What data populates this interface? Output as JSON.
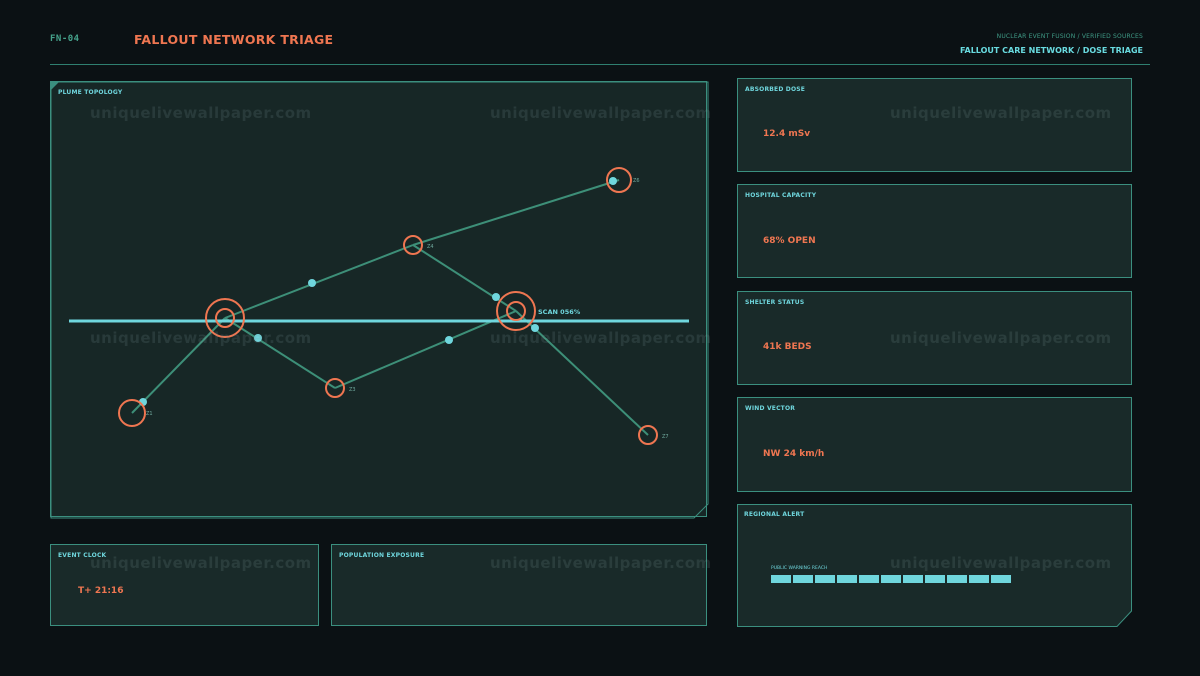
{
  "header": {
    "code": "FN-04",
    "title": "FALLOUT NETWORK TRIAGE",
    "subtitle": "NUCLEAR EVENT FUSION / VERIFIED SOURCES",
    "network_title": "FALLOUT CARE NETWORK / DOSE TRIAGE"
  },
  "plume": {
    "label": "PLUME TOPOLOGY",
    "scan_label": "SCAN 056%",
    "zones": [
      "Z1",
      "Z3",
      "Z4",
      "Z6",
      "Z7"
    ]
  },
  "metrics": [
    {
      "label": "ABSORBED DOSE",
      "value": "12.4 mSv"
    },
    {
      "label": "HOSPITAL CAPACITY",
      "value": "68% OPEN"
    },
    {
      "label": "SHELTER STATUS",
      "value": "41k BEDS"
    },
    {
      "label": "WIND VECTOR",
      "value": "NW 24 km/h"
    }
  ],
  "alert": {
    "label": "REGIONAL ALERT",
    "reach_label": "PUBLIC WARNING REACH",
    "reach_segments": 11
  },
  "event_clock": {
    "label": "EVENT CLOCK",
    "value": "T+ 21:16"
  },
  "population": {
    "label": "POPULATION EXPOSURE"
  },
  "watermark": "uniquelivewallpaper.com",
  "colors": {
    "background": "#0b1114",
    "panel": "#192a29",
    "border": "#3b8f7f",
    "accent_orange": "#ef7651",
    "accent_cyan": "#6fd6dd",
    "link_green": "#3d8f78"
  }
}
